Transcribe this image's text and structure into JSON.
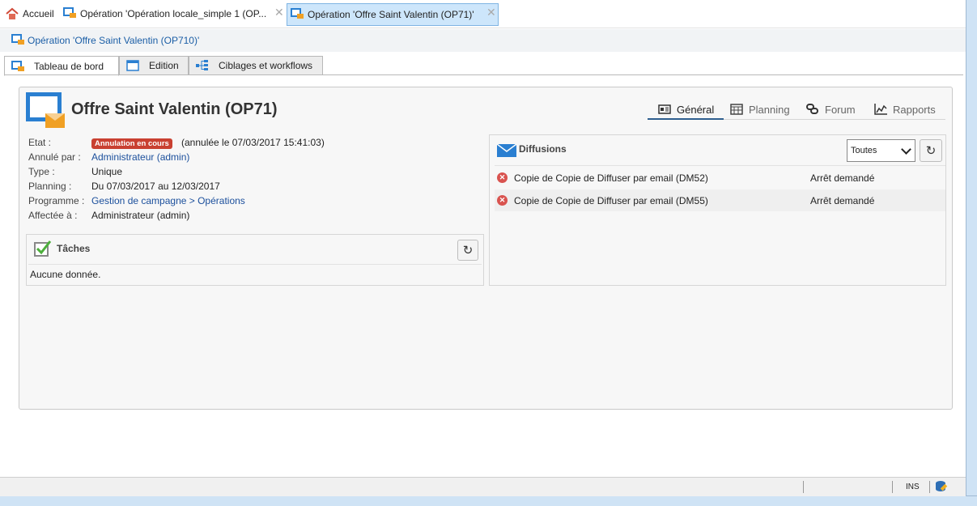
{
  "top_tabs": [
    {
      "label": "Accueil"
    },
    {
      "label": "Opération 'Opération locale_simple 1 (OP..."
    },
    {
      "label": "Opération 'Offre Saint Valentin (OP71)'"
    }
  ],
  "breadcrumb": "Opération 'Offre Saint Valentin (OP710)'",
  "sub_tabs": [
    {
      "label": "Tableau de bord"
    },
    {
      "label": "Edition"
    },
    {
      "label": "Ciblages et workflows"
    }
  ],
  "title": "Offre Saint Valentin (OP71)",
  "nav": [
    {
      "label": "Général"
    },
    {
      "label": "Planning"
    },
    {
      "label": "Forum"
    },
    {
      "label": "Rapports"
    }
  ],
  "details": {
    "etat_label": "Etat :",
    "etat_badge": "Annulation en cours",
    "etat_note": "(annulée le 07/03/2017 15:41:03)",
    "annule_label": "Annulé par :",
    "annule_value": "Administrateur (admin)",
    "type_label": "Type :",
    "type_value": "Unique",
    "planning_label": "Planning :",
    "planning_value": "Du 07/03/2017 au 12/03/2017",
    "programme_label": "Programme :",
    "programme_value": "Gestion de campagne > Opérations",
    "affectee_label": "Affectée à :",
    "affectee_value": "Administrateur (admin)"
  },
  "tasks": {
    "title": "Tâches",
    "empty": "Aucune donnée."
  },
  "diffusions": {
    "title": "Diffusions",
    "filter_value": "Toutes",
    "rows": [
      {
        "name": "Copie de Copie de Diffuser par email (DM52)",
        "status": "Arrêt demandé"
      },
      {
        "name": "Copie de Copie de Diffuser par email (DM55)",
        "status": "Arrêt demandé"
      }
    ]
  },
  "statusbar": {
    "ins": "INS"
  },
  "colors": {
    "accent": "#2a7fd1",
    "badge": "#c94031",
    "link": "#1b4f9c"
  }
}
